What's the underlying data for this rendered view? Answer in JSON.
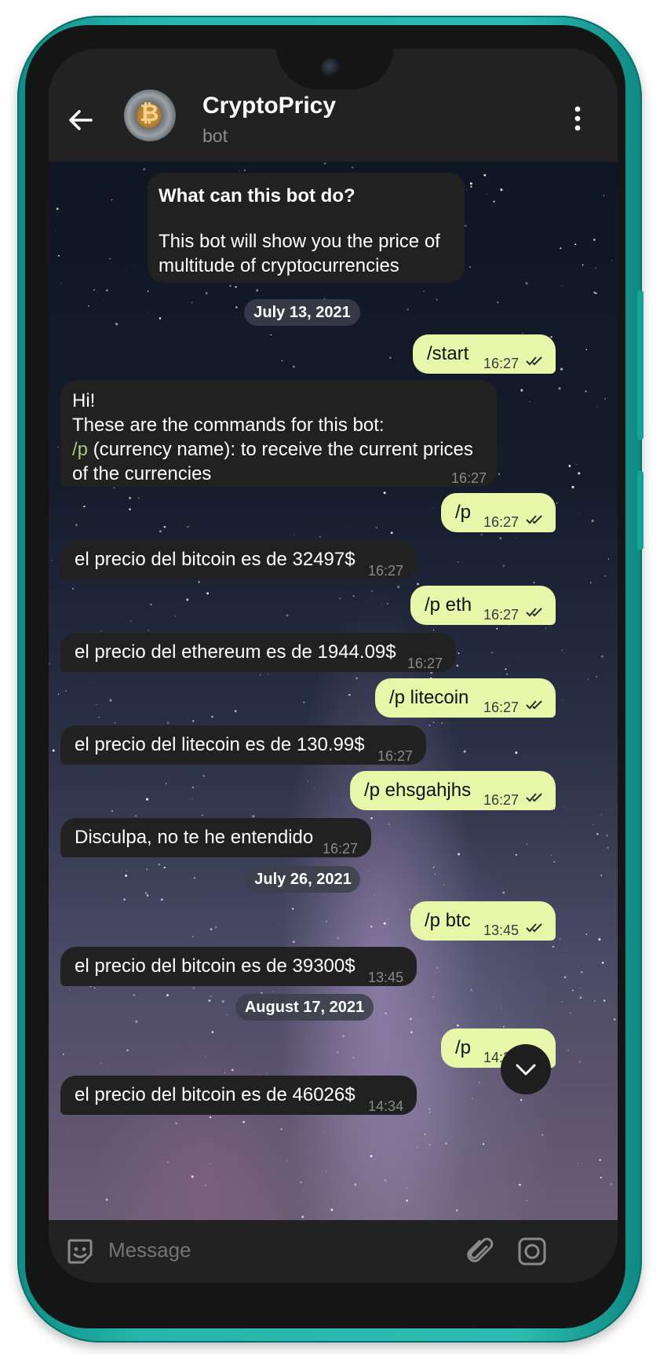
{
  "header": {
    "title": "CryptoPricy",
    "subtitle": "bot"
  },
  "intro": {
    "heading": "What can this bot do?",
    "body_line1": "This bot will show you the price of",
    "body_line2": "multitude of cryptocurrencies"
  },
  "dates": [
    "July 13, 2021",
    "July 26, 2021",
    "August 17, 2021"
  ],
  "messages": [
    {
      "dir": "out",
      "text": "/start",
      "time": "16:27"
    },
    {
      "dir": "in",
      "line1": "Hi!",
      "line2": "These are the commands for this bot:",
      "cmd": "/p",
      "line3_rest": " (currency name): to receive the current prices",
      "line4": "of the currencies",
      "time": "16:27"
    },
    {
      "dir": "out",
      "text": "/p",
      "time": "16:27"
    },
    {
      "dir": "in",
      "text": "el precio del bitcoin es de 32497$",
      "time": "16:27"
    },
    {
      "dir": "out",
      "text": "/p eth",
      "time": "16:27"
    },
    {
      "dir": "in",
      "text": "el precio del ethereum es de 1944.09$",
      "time": "16:27"
    },
    {
      "dir": "out",
      "text": "/p litecoin",
      "time": "16:27"
    },
    {
      "dir": "in",
      "text": "el precio del litecoin es de 130.99$",
      "time": "16:27"
    },
    {
      "dir": "out",
      "text": "/p ehsgahjhs",
      "time": "16:27"
    },
    {
      "dir": "in",
      "text": "Disculpa, no te he entendido",
      "time": "16:27"
    },
    {
      "dir": "out",
      "text": "/p btc",
      "time": "13:45"
    },
    {
      "dir": "in",
      "text": "el precio del bitcoin es de 39300$",
      "time": "13:45"
    },
    {
      "dir": "out",
      "text": "/p",
      "time": "14:32"
    },
    {
      "dir": "in",
      "text": "el precio del bitcoin es de 46026$",
      "time": "14:34"
    }
  ],
  "composer": {
    "placeholder": "Message"
  },
  "colors": {
    "phone_frame": "#27b6ad",
    "outgoing_bubble": "#e7f6a8",
    "incoming_bubble": "#212121",
    "command_link": "#a8c47a"
  },
  "icons": [
    "back-arrow-icon",
    "more-vert-icon",
    "chevron-down-icon",
    "emoji-icon",
    "attach-icon",
    "camera-icon",
    "double-check-icon"
  ]
}
